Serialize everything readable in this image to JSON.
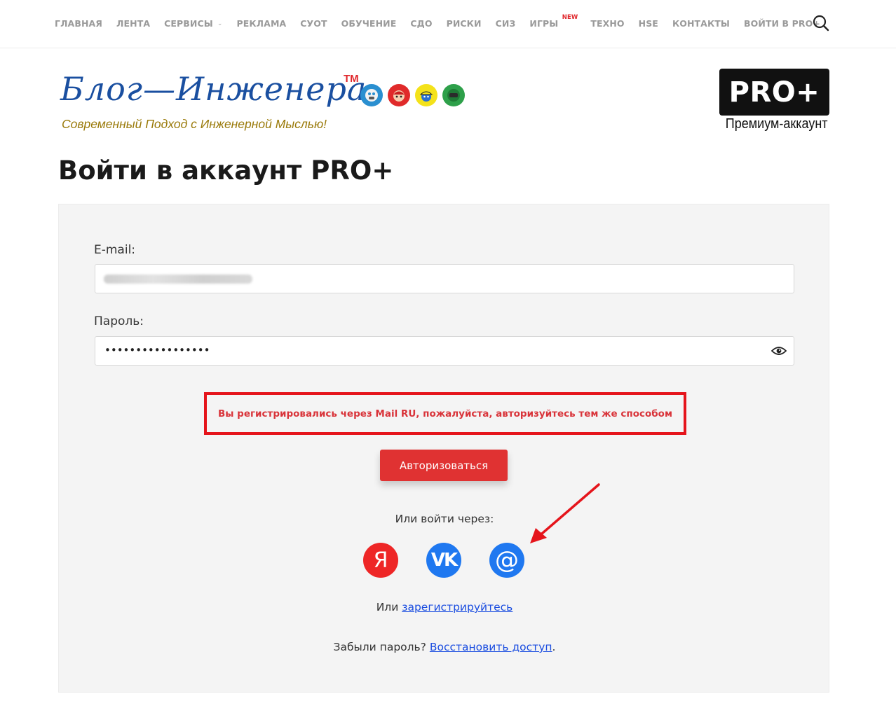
{
  "nav": {
    "items": [
      {
        "label": "ГЛАВНАЯ"
      },
      {
        "label": "ЛЕНТА"
      },
      {
        "label": "СЕРВИСЫ",
        "has_dropdown": true
      },
      {
        "label": "РЕКЛАМА"
      },
      {
        "label": "СУОТ"
      },
      {
        "label": "ОБУЧЕНИЕ"
      },
      {
        "label": "СДО"
      },
      {
        "label": "РИСКИ"
      },
      {
        "label": "СИЗ"
      },
      {
        "label": "ИГРЫ",
        "badge": "NEW"
      },
      {
        "label": "ТЕХНО"
      },
      {
        "label": "HSE"
      },
      {
        "label": "КОНТАКТЫ"
      },
      {
        "label": "ВОЙТИ В PRO+"
      }
    ],
    "search_icon": "search-icon"
  },
  "logo": {
    "title": "Блог—Инженера",
    "tm": "TM",
    "subtitle": "Современный Подход с Инженерной Мыслью!"
  },
  "pro": {
    "badge": "PRO+",
    "caption": "Премиум-аккаунт"
  },
  "page": {
    "title": "Войти в аккаунт PRO+"
  },
  "form": {
    "email_label": "E-mail:",
    "password_label": "Пароль:",
    "password_value": "•••••••••••••••••",
    "error": "Вы регистрировались через Mail RU, пожалуйста, авторизуйтесь тем же способом",
    "submit": "Авторизоваться",
    "or_via": "Или войти через:",
    "social": [
      {
        "name": "yandex",
        "glyph": "Я"
      },
      {
        "name": "vk",
        "glyph": "VK"
      },
      {
        "name": "mail-ru",
        "glyph": "@"
      }
    ],
    "or_text": "Или ",
    "register_link": "зарегистрируйтесь",
    "forgot_text": "Забыли пароль? ",
    "restore_link": "Восстановить доступ",
    "restore_suffix": "."
  },
  "colors": {
    "accent_red": "#e03232",
    "link_blue": "#1a4de0",
    "logo_blue": "#1a4fa0",
    "annotation_red": "#e5141b"
  }
}
